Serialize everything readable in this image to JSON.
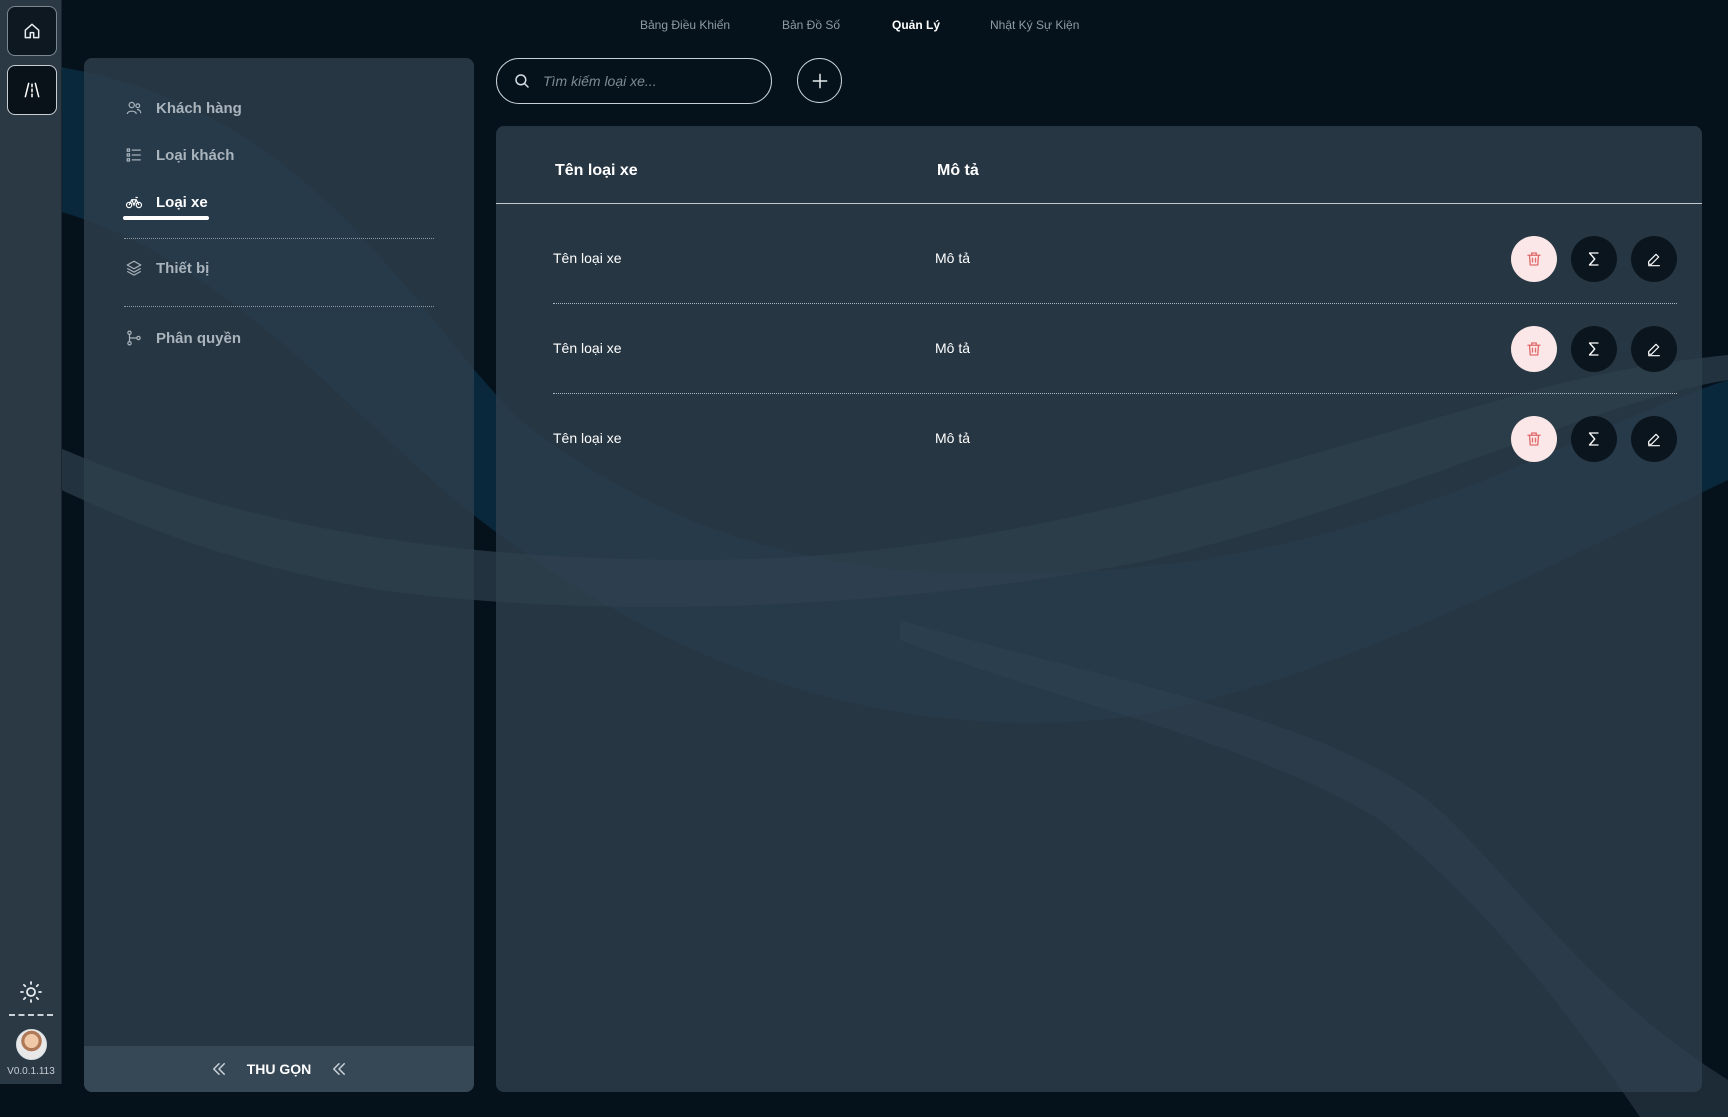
{
  "nav": {
    "tabs": [
      {
        "label": "Bảng Điều Khiển",
        "active": false
      },
      {
        "label": "Bản Đồ Số",
        "active": false
      },
      {
        "label": "Quản Lý",
        "active": true
      },
      {
        "label": "Nhật Ký Sự Kiện",
        "active": false
      }
    ]
  },
  "rail": {
    "version": "V0.0.1.113",
    "icons": [
      "home-icon",
      "road-icon",
      "sun-icon"
    ]
  },
  "sidebar": {
    "items": [
      {
        "label": "Khách hàng",
        "icon": "users-icon",
        "active": false
      },
      {
        "label": "Loại khách",
        "icon": "list-icon",
        "active": false
      },
      {
        "label": "Loại xe",
        "icon": "bicycle-icon",
        "active": true
      },
      {
        "label": "Thiết bị",
        "icon": "layers-icon",
        "active": false
      },
      {
        "label": "Phân quyền",
        "icon": "branch-icon",
        "active": false
      }
    ],
    "collapse_label": "THU GỌN"
  },
  "search": {
    "placeholder": "Tìm kiếm loại xe...",
    "value": ""
  },
  "table": {
    "columns": [
      "Tên loại xe",
      "Mô tả"
    ],
    "rows": [
      {
        "name": "Tên loại xe",
        "description": "Mô tả"
      },
      {
        "name": "Tên loại xe",
        "description": "Mô tả"
      },
      {
        "name": "Tên loại xe",
        "description": "Mô tả"
      }
    ],
    "row_actions": [
      "trash-icon",
      "sigma-icon",
      "pencil-icon"
    ]
  },
  "colors": {
    "background": "#06121b",
    "panel": "#2f404e",
    "delete_bg": "#fbe7e7",
    "delete_icon": "#e06b6b",
    "action_bg": "#0b151d"
  }
}
